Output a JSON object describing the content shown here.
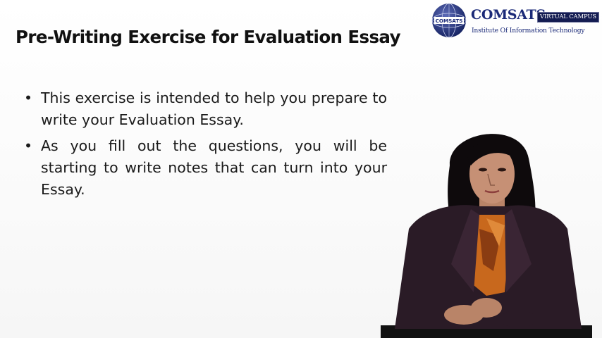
{
  "logo": {
    "name": "COMSATS",
    "tag": "VIRTUAL CAMPUS",
    "subtitle": "Institute Of Information Technology",
    "globe_text": "COMSATS"
  },
  "slide": {
    "title": "Pre-Writing Exercise for Evaluation Essay",
    "bullet_glyph": "•",
    "bullets": [
      "This exercise is intended to help you prepare to write your Evaluation Essay.",
      "As you fill out the questions, you will be starting to write notes that can turn into your Essay."
    ]
  },
  "colors": {
    "brand_blue": "#1b2a78",
    "tag_bg": "#141c52",
    "jacket": "#2a1b26",
    "scarf": "#c8681d"
  }
}
